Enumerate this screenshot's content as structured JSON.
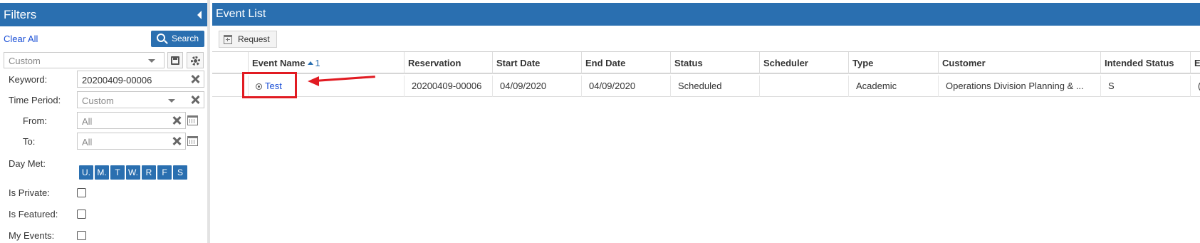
{
  "filters": {
    "title": "Filters",
    "clear_all": "Clear All",
    "search_label": "Search",
    "preset_value": "Custom",
    "keyword_label": "Keyword:",
    "keyword_value": "20200409-00006",
    "time_period_label": "Time Period:",
    "time_period_value": "Custom",
    "from_label": "From:",
    "from_value": "All",
    "to_label": "To:",
    "to_value": "All",
    "day_met_label": "Day Met:",
    "days": [
      "U.",
      "M.",
      "T",
      "W.",
      "R",
      "F",
      "S"
    ],
    "is_private_label": "Is Private:",
    "is_featured_label": "Is Featured:",
    "my_events_label": "My Events:"
  },
  "main": {
    "title": "Event List",
    "request_label": "Request",
    "sort_indicator": "1",
    "columns": [
      "Event Name",
      "Reservation",
      "Start Date",
      "End Date",
      "Status",
      "Scheduler",
      "Type",
      "Customer",
      "Intended Status",
      "E"
    ],
    "rows": [
      {
        "event_name": "Test",
        "reservation": "20200409-00006",
        "start_date": "04/09/2020",
        "end_date": "04/09/2020",
        "status": "Scheduled",
        "scheduler": "",
        "type": "Academic",
        "customer": "Operations Division Planning & ...",
        "intended_status": "S",
        "e": "("
      }
    ]
  },
  "colors": {
    "header_blue": "#2a6fb0",
    "link_blue": "#1a4fd6",
    "annotation_red": "#e11b22"
  }
}
